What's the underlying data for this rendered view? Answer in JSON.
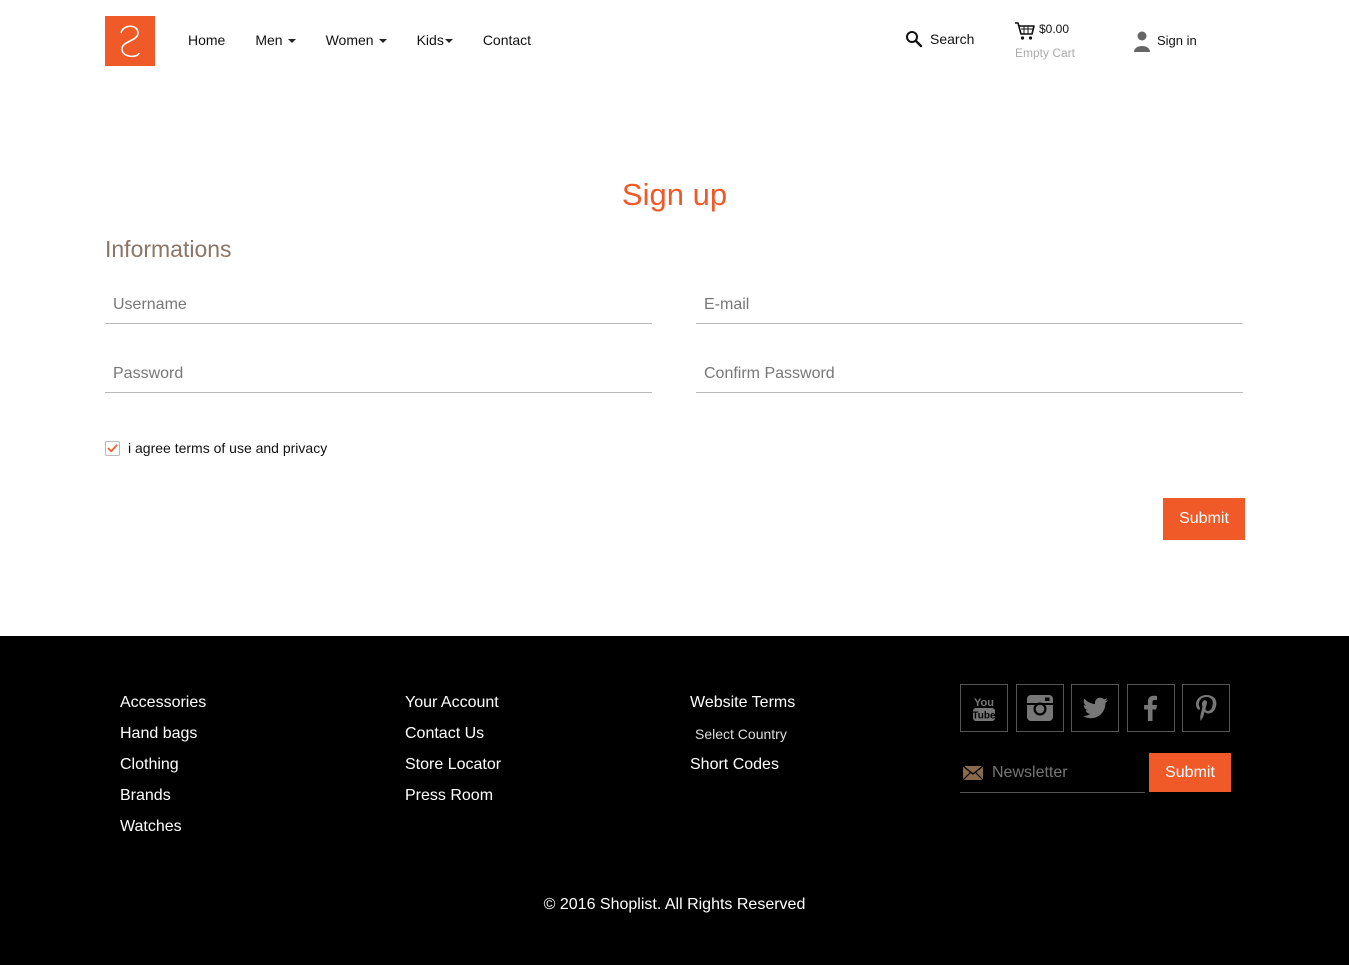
{
  "header": {
    "logo_name": "brand-logo",
    "nav": [
      {
        "label": "Home",
        "dropdown": false
      },
      {
        "label": "Men",
        "dropdown": true
      },
      {
        "label": "Women",
        "dropdown": true
      },
      {
        "label": "Kids",
        "dropdown": true
      },
      {
        "label": "Contact",
        "dropdown": false
      }
    ],
    "search_label": "Search",
    "cart": {
      "price": "$0.00",
      "status": "Empty Cart"
    },
    "signin_label": "Sign in"
  },
  "main": {
    "title": "Sign up",
    "section_title": "Informations",
    "fields": {
      "username_placeholder": "Username",
      "email_placeholder": "E-mail",
      "password_placeholder": "Password",
      "confirm_placeholder": "Confirm Password"
    },
    "agree_label": "i agree terms of use and privacy",
    "agree_checked": true,
    "submit_label": "Submit"
  },
  "footer": {
    "col1": [
      "Accessories",
      "Hand bags",
      "Clothing",
      "Brands",
      "Watches"
    ],
    "col2": [
      "Your Account",
      "Contact Us",
      "Store Locator",
      "Press Room"
    ],
    "col3": [
      "Website Terms",
      "Select Country",
      "Short Codes"
    ],
    "socials": [
      "youtube-icon",
      "instagram-icon",
      "twitter-icon",
      "facebook-icon",
      "pinterest-icon"
    ],
    "newsletter_placeholder": "Newsletter",
    "newsletter_submit": "Submit",
    "copyright": "© 2016 Shoplist. All Rights Reserved"
  },
  "colors": {
    "accent": "#f05a28",
    "footer_bg": "#000000",
    "section_title": "#8a7566"
  }
}
